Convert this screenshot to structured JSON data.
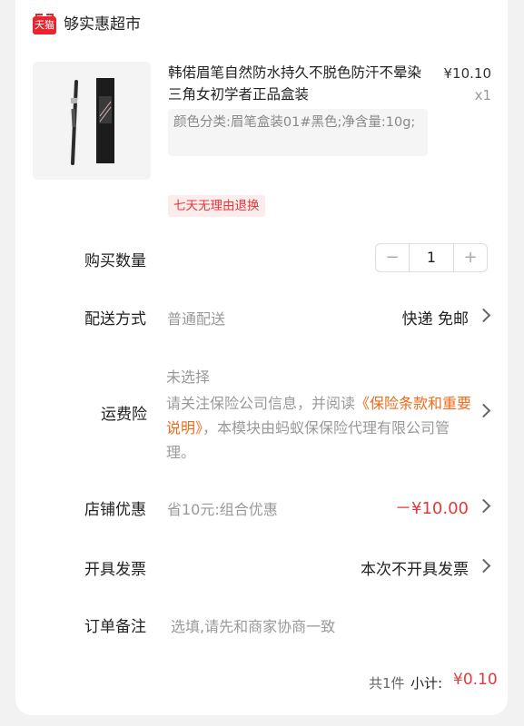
{
  "store": {
    "logo_text": "天猫",
    "name": "够实惠超市"
  },
  "product": {
    "title": "韩偌眉笔自然防水持久不脱色防汗不晕染三角女初学者正品盒装",
    "price": "¥10.10",
    "quantity_label": "x1",
    "sku": "颜色分类:眉笔盒装01#黑色;净含量:10g;",
    "tag": "七天无理由退换",
    "image": "eyebrow-pencil-product-photo"
  },
  "quantity": {
    "label": "购买数量",
    "value": "1",
    "minus": "−",
    "plus": "+"
  },
  "delivery": {
    "label": "配送方式",
    "type": "普通配送",
    "value": "快递 免邮"
  },
  "insurance": {
    "label": "运费险",
    "status": "未选择",
    "text_before": "请关注保险公司信息，并阅读",
    "link": "《保险条款和重要说明》",
    "text_after": "，本模块由蚂蚁保保险代理有限公司管理。"
  },
  "shop_discount": {
    "label": "店铺优惠",
    "desc": "省10元:组合优惠",
    "value": "－¥10.00"
  },
  "invoice": {
    "label": "开具发票",
    "value": "本次不开具发票"
  },
  "note": {
    "label": "订单备注",
    "placeholder": "选填,请先和商家协商一致"
  },
  "footer": {
    "count": "共1件",
    "subtotal_label": "小计:",
    "subtotal_value": "¥0.10"
  },
  "colors": {
    "accent_red": "#e4393c",
    "link_orange": "#f06a1b",
    "tmall_red": "#e8252f"
  }
}
